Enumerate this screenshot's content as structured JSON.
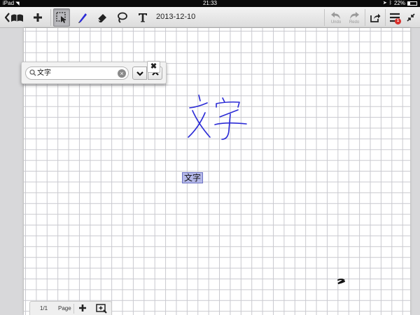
{
  "status_bar": {
    "device": "iPad",
    "time": "21:33",
    "battery": "22%",
    "battery_level": 0.22
  },
  "toolbar": {
    "date": "2013-12-10",
    "undo_label": "Undo",
    "redo_label": "Redo",
    "notification_count": "1",
    "icons": [
      "back-notebook-icon",
      "add-page-icon",
      "select-tool-icon",
      "pen-icon",
      "eraser-icon",
      "lasso-icon",
      "text-tool-icon",
      "undo-icon",
      "redo-icon",
      "share-icon",
      "menu-icon"
    ]
  },
  "search": {
    "query": "文字"
  },
  "canvas": {
    "handwritten_text": "文字",
    "highlight_text": "文字"
  },
  "page_bar": {
    "page_indicator": "1/1",
    "page_label": "Page"
  },
  "colors": {
    "ink": "#2b2bd6",
    "highlight": "#b3b7e8",
    "toolbar_icon": "#222222",
    "badge": "#d8302b"
  }
}
